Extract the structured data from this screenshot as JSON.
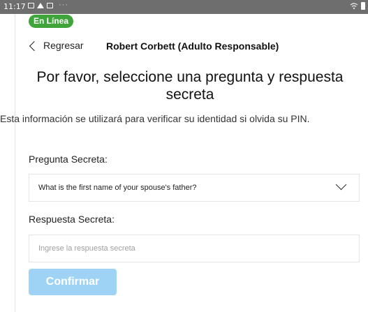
{
  "status_bar": {
    "time": "11:17",
    "overflow": "···",
    "icons_left": [
      "image-icon",
      "cloud-icon",
      "photo-icon"
    ],
    "icons_right": [
      "wifi-icon",
      "battery-icon"
    ]
  },
  "badge": {
    "label": "En Línea",
    "color": "#3fa53a"
  },
  "nav": {
    "back_label": "Regresar",
    "header_name": "Robert Corbett (Adulto Responsable)"
  },
  "page": {
    "title": "Por favor, seleccione una pregunta y respuesta secreta",
    "info": "Esta información se utilizará para verificar su identidad si olvida su PIN."
  },
  "form": {
    "question_label": "Pregunta Secreta:",
    "question_value": "What is the first name of your spouse's father?",
    "answer_label": "Respuesta Secreta:",
    "answer_placeholder": "Ingrese la respuesta secreta",
    "answer_value": ""
  },
  "confirm_button": {
    "label": "Confirmar",
    "color": "#9fd3f5"
  }
}
